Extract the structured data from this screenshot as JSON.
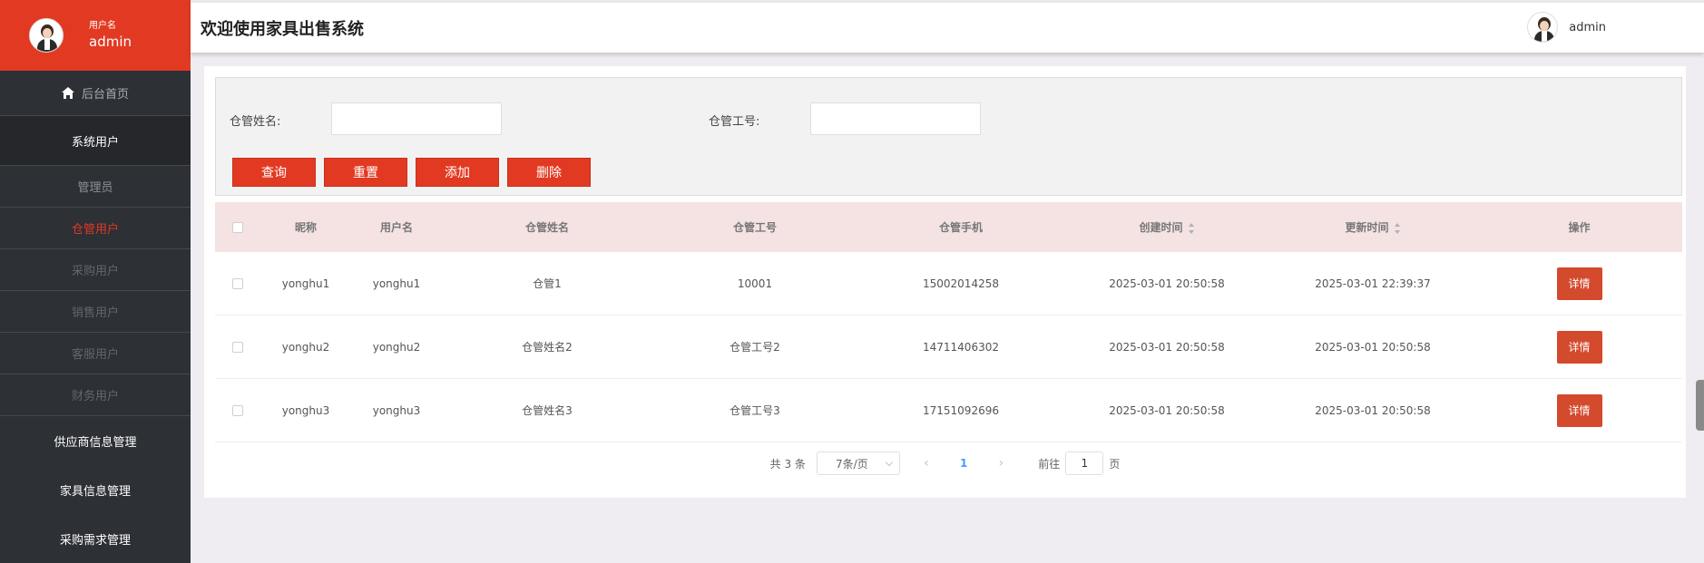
{
  "sidebar": {
    "user_label": "用户名",
    "user_name": "admin",
    "home": "后台首页",
    "items": [
      {
        "label": "系统用户"
      },
      {
        "label": "管理员"
      },
      {
        "label": "仓管用户"
      },
      {
        "label": "采购用户"
      },
      {
        "label": "销售用户"
      },
      {
        "label": "客服用户"
      },
      {
        "label": "财务用户"
      },
      {
        "label": "供应商信息管理"
      },
      {
        "label": "家具信息管理"
      },
      {
        "label": "采购需求管理"
      }
    ]
  },
  "header": {
    "title": "欢迎使用家具出售系统",
    "user": "admin"
  },
  "search": {
    "name_label": "仓管姓名:",
    "name_value": "",
    "id_label": "仓管工号:",
    "id_value": "",
    "buttons": [
      "查询",
      "重置",
      "添加",
      "删除"
    ]
  },
  "table": {
    "headers": [
      "昵称",
      "用户名",
      "仓管姓名",
      "仓管工号",
      "仓管手机",
      "创建时间",
      "更新时间",
      "操作"
    ],
    "rows": [
      {
        "nickname": "yonghu1",
        "username": "yonghu1",
        "name": "仓管1",
        "id": "10001",
        "phone": "15002014258",
        "created": "2025-03-01 20:50:58",
        "updated": "2025-03-01 22:39:37",
        "action": "详情"
      },
      {
        "nickname": "yonghu2",
        "username": "yonghu2",
        "name": "仓管姓名2",
        "id": "仓管工号2",
        "phone": "14711406302",
        "created": "2025-03-01 20:50:58",
        "updated": "2025-03-01 20:50:58",
        "action": "详情"
      },
      {
        "nickname": "yonghu3",
        "username": "yonghu3",
        "name": "仓管姓名3",
        "id": "仓管工号3",
        "phone": "17151092696",
        "created": "2025-03-01 20:50:58",
        "updated": "2025-03-01 20:50:58",
        "action": "详情"
      }
    ]
  },
  "pagination": {
    "total": "共 3 条",
    "page_size": "7条/页",
    "current": "1",
    "goto_label": "前往",
    "goto_value": "1",
    "page_unit": "页"
  },
  "colors": {
    "accent": "#e23a22",
    "sidebar_bg": "#2d3035",
    "header_row_bg": "#f5e3e4",
    "detail_btn": "#d44a2c",
    "page_bg": "#efedf2"
  }
}
